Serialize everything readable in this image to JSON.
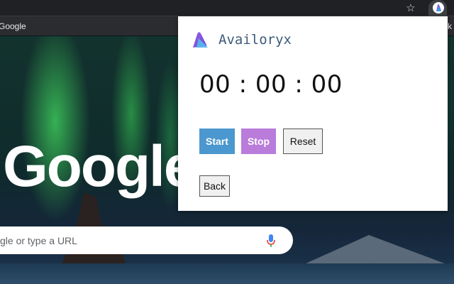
{
  "browser": {
    "bookmarks": {
      "google_label": "Google",
      "right_label": "rk"
    }
  },
  "ntp": {
    "logo_text": "Google",
    "search_placeholder": "gle or type a URL"
  },
  "popup": {
    "app_name": "Availoryx",
    "timer": "00 : 00 : 00",
    "buttons": {
      "start": "Start",
      "stop": "Stop",
      "reset": "Reset",
      "back": "Back"
    }
  },
  "colors": {
    "start_bg": "#4b97cf",
    "stop_bg": "#b97cdb",
    "title_color": "#3d5a7a"
  },
  "icons": [
    "star-icon",
    "extension-icon",
    "mic-icon",
    "availoryx-logo-icon"
  ]
}
